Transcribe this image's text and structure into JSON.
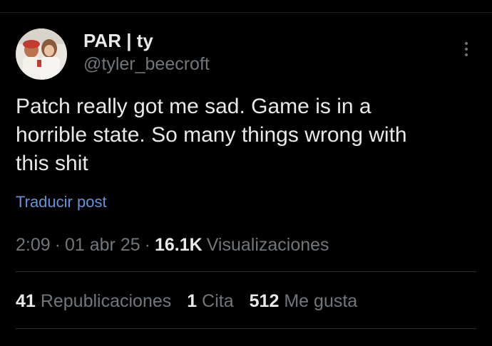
{
  "user": {
    "display_name": "PAR | ty",
    "handle": "@tyler_beecroft"
  },
  "post": {
    "text": "Patch really got me sad. Game is in a\nhorrible state. So many things wrong with\nthis shit",
    "translate_label": "Traducir post"
  },
  "meta": {
    "time": "2:09",
    "date": "01 abr 25",
    "views_count": "16.1K",
    "views_label": "Visualizaciones",
    "separator": "·"
  },
  "stats": {
    "reposts_count": "41",
    "reposts_label": "Republicaciones",
    "quotes_count": "1",
    "quotes_label": "Cita",
    "likes_count": "512",
    "likes_label": "Me gusta"
  },
  "icons": {
    "more": "more-vertical-icon"
  },
  "colors": {
    "background": "#000000",
    "primary_text": "#e7e9ea",
    "secondary_text": "#71767b",
    "link": "#6a93d6",
    "divider": "#2a2d31"
  }
}
